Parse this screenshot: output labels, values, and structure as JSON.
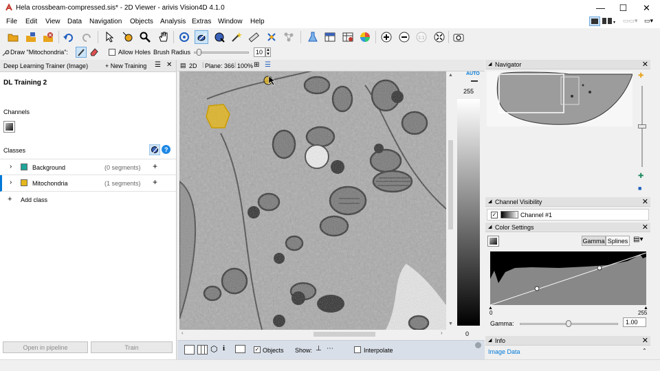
{
  "window": {
    "title": "Hela crossbeam-compressed.sis* - 2D Viewer - arivis Vision4D 4.1.0",
    "minimize": "—",
    "maximize": "☐",
    "close": "✕"
  },
  "menu": [
    "File",
    "Edit",
    "View",
    "Data",
    "Navigation",
    "Objects",
    "Analysis",
    "Extras",
    "Window",
    "Help"
  ],
  "draw_row": {
    "draw_label": "Draw \"Mitochondria\":",
    "allow_holes": "Allow Holes",
    "brush_radius_label": "Brush Radius",
    "brush_radius_value": "10",
    "brush_radius_fraction": 0.05
  },
  "trainer": {
    "panel_title": "Deep Learning Trainer (Image)",
    "new_training": "+ New Training",
    "training_name": "DL Training 2",
    "channels_label": "Channels",
    "classes_label": "Classes",
    "classes": [
      {
        "name": "Background",
        "count": "(0 segments)",
        "color": "#1fa59a",
        "selected": false
      },
      {
        "name": "Mitochondria",
        "count": "(1 segments)",
        "color": "#e5b71c",
        "selected": true
      }
    ],
    "add_class": "Add class",
    "open_pipeline": "Open in pipeline",
    "train": "Train"
  },
  "viewer": {
    "mode": "2D",
    "plane": "Plane: 366",
    "zoom": "100%",
    "auto": "AUTO",
    "max": "255",
    "min": "0",
    "objects": "Objects",
    "show": "Show:",
    "interpolate": "Interpolate"
  },
  "navigator": {
    "title": "Navigator"
  },
  "channel_visibility": {
    "title": "Channel Visibility",
    "channel": "Channel #1"
  },
  "color_settings": {
    "title": "Color Settings",
    "tab_gamma": "Gamma",
    "tab_splines": "Splines",
    "hist_min": "0",
    "hist_max": "255",
    "gamma_label": "Gamma:",
    "gamma_value": "1.00"
  },
  "info": {
    "title": "Info",
    "image_data": "Image Data"
  },
  "colors": {
    "accent": "#0078d7",
    "mito": "#e5b71c",
    "background_class": "#1fa59a"
  }
}
